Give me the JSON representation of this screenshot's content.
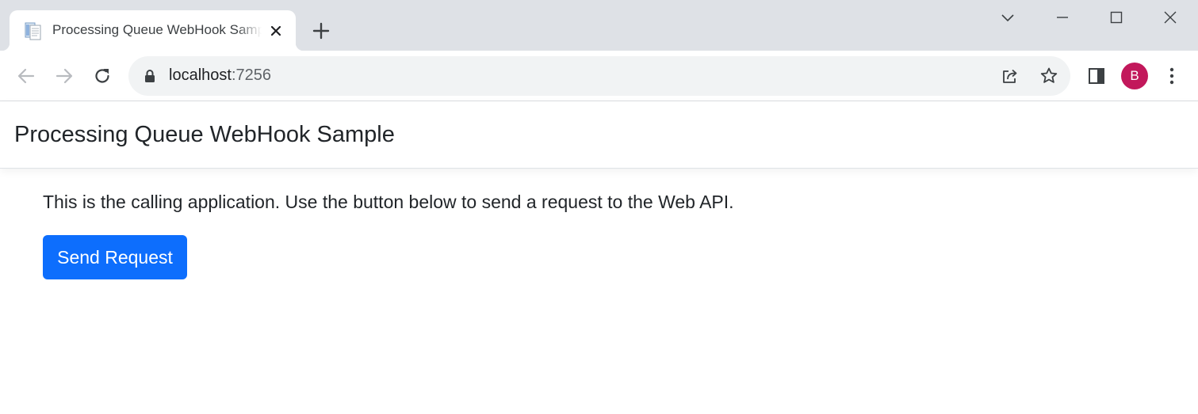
{
  "browser": {
    "tab": {
      "title": "Processing Queue WebHook Sample"
    },
    "address": {
      "host": "localhost",
      "port": ":7256"
    },
    "profile": {
      "initial": "B",
      "color": "#c2185b"
    },
    "icons": {
      "favicon": "document-icon",
      "tab_close": "close-icon",
      "new_tab": "plus-icon",
      "tab_search": "chevron-down-icon",
      "minimize": "minimize-icon",
      "maximize": "maximize-icon",
      "close_window": "close-window-icon",
      "back": "back-arrow-icon",
      "forward": "forward-arrow-icon",
      "reload": "reload-icon",
      "lock": "lock-icon",
      "share": "share-icon",
      "bookmark": "star-icon",
      "side_panel": "side-panel-icon",
      "menu": "kebab-menu-icon"
    }
  },
  "page": {
    "header": {
      "title": "Processing Queue WebHook Sample"
    },
    "intro": "This is the calling application. Use the button below to send a request to the Web API.",
    "send_button": "Send Request",
    "accent_color": "#0d6efd"
  }
}
